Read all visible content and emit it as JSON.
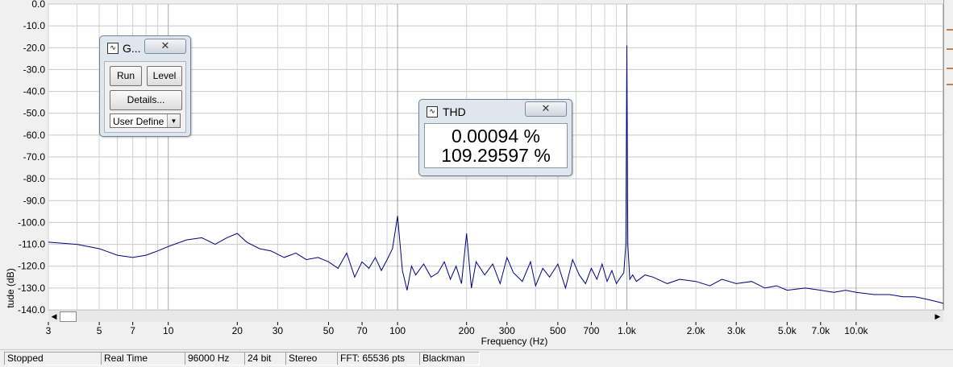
{
  "chart_data": {
    "type": "line",
    "xscale": "log",
    "xlim": [
      3,
      24000
    ],
    "ylim": [
      -140,
      0
    ],
    "xlabel": "Frequency (Hz)",
    "ylabel": "tude (dB)",
    "grid": true,
    "y_ticks": [
      0,
      -10,
      -20,
      -30,
      -40,
      -50,
      -60,
      -70,
      -80,
      -90,
      -100,
      -110,
      -120,
      -130,
      -140
    ],
    "y_tick_labels": [
      "0.0",
      "-10.0",
      "-20.0",
      "-30.0",
      "-40.0",
      "-50.0",
      "-60.0",
      "-70.0",
      "-80.0",
      "-90.0",
      "-100.0",
      "-110.0",
      "-120.0",
      "-130.0",
      "-140.0"
    ],
    "x_ticks": [
      3,
      5,
      7,
      10,
      20,
      30,
      50,
      70,
      100,
      200,
      300,
      500,
      700,
      1000,
      2000,
      3000,
      5000,
      7000,
      10000
    ],
    "x_tick_labels": [
      "3",
      "5",
      "7",
      "10",
      "20",
      "30",
      "50",
      "70",
      "100",
      "200",
      "300",
      "500",
      "700",
      "1.0k",
      "2.0k",
      "3.0k",
      "5.0k",
      "7.0k",
      "10.0k"
    ],
    "series": [
      {
        "color": "#000080",
        "x": [
          3,
          4,
          5,
          6,
          7,
          8,
          9,
          10,
          12,
          14,
          16,
          18,
          20,
          22,
          25,
          28,
          32,
          36,
          40,
          45,
          50,
          55,
          60,
          65,
          70,
          75,
          80,
          85,
          90,
          95,
          100,
          105,
          110,
          115,
          120,
          130,
          140,
          150,
          160,
          170,
          180,
          190,
          200,
          210,
          220,
          240,
          260,
          280,
          300,
          320,
          350,
          380,
          400,
          430,
          460,
          500,
          540,
          580,
          620,
          660,
          700,
          740,
          780,
          820,
          860,
          900,
          940,
          970,
          990,
          1000,
          1010,
          1030,
          1060,
          1100,
          1200,
          1300,
          1500,
          1700,
          2000,
          2300,
          2600,
          3000,
          3500,
          4000,
          4500,
          5000,
          6000,
          7000,
          8000,
          9000,
          10000,
          12000,
          14000,
          16000,
          18000,
          20000,
          22000,
          24000
        ],
        "y": [
          -109,
          -110,
          -112,
          -115,
          -116,
          -115,
          -113,
          -111,
          -108,
          -107,
          -110,
          -107,
          -105,
          -109,
          -112,
          -113,
          -116,
          -114,
          -117,
          -116,
          -118,
          -121,
          -114,
          -125,
          -118,
          -121,
          -116,
          -122,
          -117,
          -112,
          -97,
          -122,
          -131,
          -120,
          -124,
          -119,
          -125,
          -123,
          -118,
          -126,
          -120,
          -128,
          -105,
          -130,
          -118,
          -124,
          -119,
          -128,
          -116,
          -123,
          -127,
          -118,
          -129,
          -121,
          -125,
          -119,
          -130,
          -117,
          -124,
          -128,
          -121,
          -126,
          -119,
          -127,
          -122,
          -128,
          -125,
          -123,
          -110,
          -19,
          -110,
          -126,
          -124,
          -127,
          -124,
          -125,
          -128,
          -126,
          -127,
          -129,
          -126,
          -128,
          -127,
          -130,
          -129,
          -131,
          -130,
          -131,
          -132,
          -131,
          -132,
          -133,
          -133,
          -134,
          -134,
          -135,
          -136,
          -137
        ]
      }
    ]
  },
  "thd_window": {
    "title": "THD",
    "value_1": "0.00094 %",
    "value_2": "109.29597 %",
    "close_glyph": "✕"
  },
  "gen_window": {
    "title": "G...",
    "run_label": "Run",
    "level_label": "Level",
    "details_label": "Details...",
    "select_value": "User Define",
    "close_glyph": "✕"
  },
  "statusbar": {
    "state": "Stopped",
    "mode": "Real Time",
    "sample_rate": "96000 Hz",
    "bit_depth": "24 bit",
    "channels": "Stereo",
    "fft_size": "FFT: 65536 pts",
    "window": "Blackman"
  },
  "icons": {
    "app": "wave-icon",
    "scroll_left": "left-arrow-icon",
    "scroll_right": "right-arrow-icon",
    "dropdown": "chevron-down-icon"
  }
}
